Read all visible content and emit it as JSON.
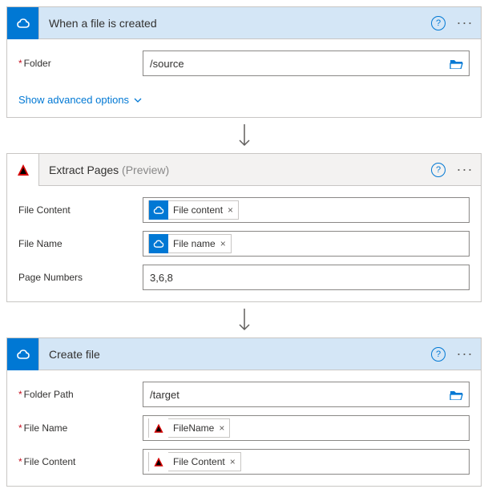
{
  "step1": {
    "title": "When a file is created",
    "folderLabel": "Folder",
    "folderValue": "/source",
    "advanced": "Show advanced options"
  },
  "step2": {
    "title": "Extract Pages",
    "previewTag": "(Preview)",
    "fileContentLabel": "File Content",
    "fileContentToken": "File content",
    "fileNameLabel": "File Name",
    "fileNameToken": "File name",
    "pageNumbersLabel": "Page Numbers",
    "pageNumbersValue": "3,6,8"
  },
  "step3": {
    "title": "Create file",
    "folderPathLabel": "Folder Path",
    "folderPathValue": "/target",
    "fileNameLabel": "File Name",
    "fileNameToken": "FileName",
    "fileContentLabel": "File Content",
    "fileContentToken": "File Content"
  }
}
